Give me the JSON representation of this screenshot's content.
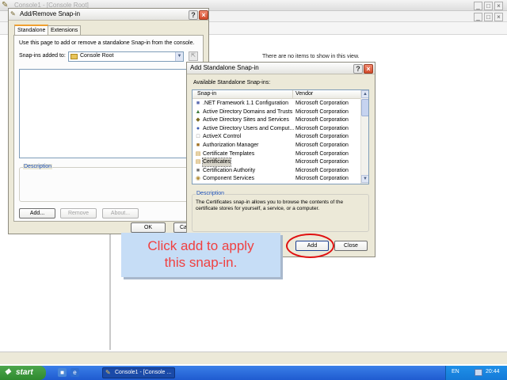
{
  "console": {
    "title": "Console1 - [Console Root]",
    "list_empty_text": "There are no items to show in this view."
  },
  "add_remove_dialog": {
    "title": "Add/Remove Snap-in",
    "tabs": [
      {
        "label": "Standalone"
      },
      {
        "label": "Extensions"
      }
    ],
    "intro_text": "Use this page to add or remove a standalone Snap-in from the console.",
    "snapins_added_to_label": "Snap-ins added to:",
    "snapins_added_to_value": "Console Root",
    "description_label": "Description",
    "add_label": "Add...",
    "remove_label": "Remove",
    "about_label": "About...",
    "ok_label": "OK",
    "cancel_label": "Ca"
  },
  "standalone_dialog": {
    "title": "Add Standalone Snap-in",
    "available_label": "Available Standalone Snap-ins:",
    "columns": {
      "snapin": "Snap-in",
      "vendor": "Vendor"
    },
    "rows": [
      {
        "name": ".NET Framework 1.1 Configuration",
        "vendor": "Microsoft Corporation",
        "icon": "net-icon"
      },
      {
        "name": "Active Directory Domains and Trusts",
        "vendor": "Microsoft Corporation",
        "icon": "domains-icon"
      },
      {
        "name": "Active Directory Sites and Services",
        "vendor": "Microsoft Corporation",
        "icon": "sites-icon"
      },
      {
        "name": "Active Directory Users and Comput...",
        "vendor": "Microsoft Corporation",
        "icon": "users-icon"
      },
      {
        "name": "ActiveX Control",
        "vendor": "Microsoft Corporation",
        "icon": "activex-icon"
      },
      {
        "name": "Authorization Manager",
        "vendor": "Microsoft Corporation",
        "icon": "authorization-icon"
      },
      {
        "name": "Certificate Templates",
        "vendor": "Microsoft Corporation",
        "icon": "template-icon"
      },
      {
        "name": "Certificates",
        "vendor": "Microsoft Corporation",
        "icon": "certificate-icon",
        "selected": true
      },
      {
        "name": "Certification Authority",
        "vendor": "Microsoft Corporation",
        "icon": "ca-icon"
      },
      {
        "name": "Component Services",
        "vendor": "Microsoft Corporation",
        "icon": "component-icon"
      }
    ],
    "description_label": "Description",
    "description_text": "The Certificates snap-in allows you to browse the contents of the certificate stores for yourself, a service, or a computer.",
    "add_label": "Add",
    "close_label": "Close"
  },
  "callout": {
    "line1": "Click add to apply",
    "line2": "this snap-in.",
    "color": "#f04040"
  },
  "taskbar": {
    "start_label": "start",
    "task_label": "Console1 - [Console ...",
    "language": "EN",
    "clock": "20:44"
  }
}
